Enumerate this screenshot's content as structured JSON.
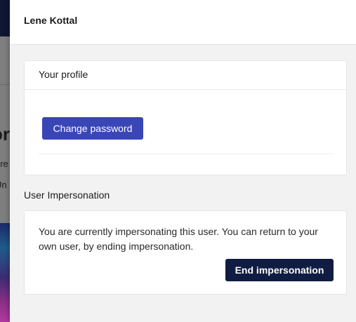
{
  "background": {
    "heading_fragment": "or",
    "line_1": "ere",
    "line_2": "Un"
  },
  "panel": {
    "title": "Lene Kottal"
  },
  "profile": {
    "title": "Your profile",
    "change_password_label": "Change password"
  },
  "impersonation": {
    "section_title": "User Impersonation",
    "message": "You are currently impersonating this user. You can return to your own user, by ending impersonation.",
    "end_button_label": "End impersonation"
  },
  "colors": {
    "primary_button": "#3a45b6",
    "dark_button": "#101c42",
    "panel_background": "#f3f2f2"
  }
}
